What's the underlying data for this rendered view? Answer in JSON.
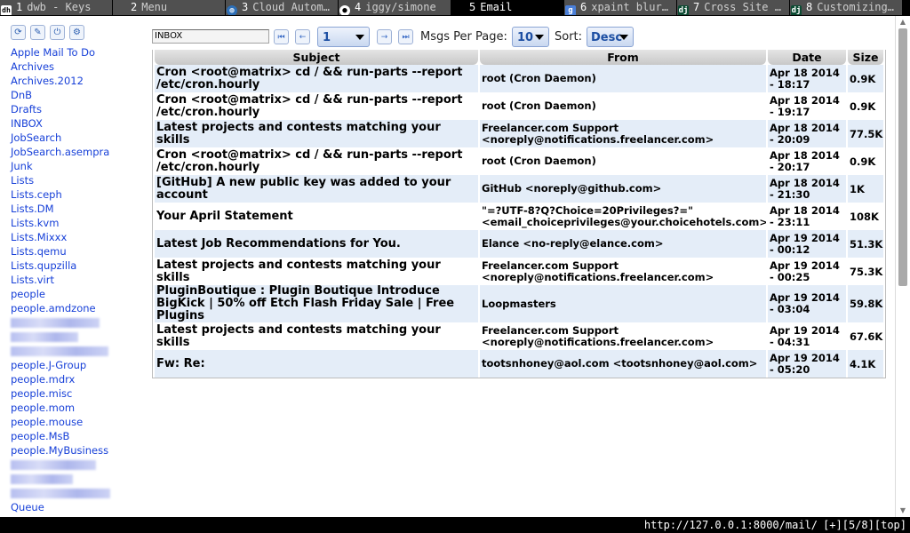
{
  "tabs": [
    {
      "num": "1",
      "title": "dwb - Keys",
      "icon": "dh",
      "active": false
    },
    {
      "num": "2",
      "title": "Menu",
      "icon": "",
      "active": false
    },
    {
      "num": "3",
      "title": "Cloud Autom…",
      "icon": "globe",
      "active": false
    },
    {
      "num": "4",
      "title": "iggy/simone",
      "icon": "github",
      "active": false
    },
    {
      "num": "5",
      "title": "Email",
      "icon": "",
      "active": true
    },
    {
      "num": "6",
      "title": "xpaint blur…",
      "icon": "g",
      "active": false
    },
    {
      "num": "7",
      "title": "Cross Site …",
      "icon": "dj",
      "active": false
    },
    {
      "num": "8",
      "title": "Customizing…",
      "icon": "dj",
      "active": false
    }
  ],
  "sidebar": {
    "tool_icons": [
      "refresh-icon",
      "compose-icon",
      "power-icon",
      "settings-icon"
    ],
    "folders": [
      {
        "label": "Apple Mail To Do"
      },
      {
        "label": "Archives"
      },
      {
        "label": "Archives.2012"
      },
      {
        "label": "DnB"
      },
      {
        "label": "Drafts"
      },
      {
        "label": "INBOX"
      },
      {
        "label": "JobSearch"
      },
      {
        "label": "JobSearch.asempra"
      },
      {
        "label": "Junk"
      },
      {
        "label": "Lists"
      },
      {
        "label": "Lists.ceph"
      },
      {
        "label": "Lists.DM"
      },
      {
        "label": "Lists.kvm"
      },
      {
        "label": "Lists.Mixxx"
      },
      {
        "label": "Lists.qemu"
      },
      {
        "label": "Lists.qupzilla"
      },
      {
        "label": "Lists.virt"
      },
      {
        "label": "people"
      },
      {
        "label": "people.amdzone"
      },
      {
        "label": "",
        "redacted": true
      },
      {
        "label": "",
        "redacted": true
      },
      {
        "label": "",
        "redacted": true
      },
      {
        "label": "people.J-Group"
      },
      {
        "label": "people.mdrx"
      },
      {
        "label": "people.misc"
      },
      {
        "label": "people.mom"
      },
      {
        "label": "people.mouse"
      },
      {
        "label": "people.MsB"
      },
      {
        "label": "people.MyBusiness"
      },
      {
        "label": "",
        "redacted": true
      },
      {
        "label": "",
        "redacted": true
      },
      {
        "label": "",
        "redacted": true
      },
      {
        "label": "Queue"
      }
    ]
  },
  "toolbar": {
    "mailbox": "INBOX",
    "page": "1",
    "per_page_label": "Msgs Per Page:",
    "per_page": "10",
    "sort_label": "Sort:",
    "sort": "Desc"
  },
  "table": {
    "headers": {
      "subject": "Subject",
      "from": "From",
      "date": "Date",
      "size": "Size"
    },
    "rows": [
      {
        "subject": "Cron <root@matrix> cd / && run-parts --report /etc/cron.hourly",
        "from": "root (Cron Daemon)",
        "date": "Apr 18 2014 - 18:17",
        "size": "0.9K"
      },
      {
        "subject": "Cron <root@matrix> cd / && run-parts --report /etc/cron.hourly",
        "from": "root (Cron Daemon)",
        "date": "Apr 18 2014 - 19:17",
        "size": "0.9K"
      },
      {
        "subject": "Latest projects and contests matching your skills",
        "from": "Freelancer.com Support <noreply@notifications.freelancer.com>",
        "date": "Apr 18 2014 - 20:09",
        "size": "77.5K"
      },
      {
        "subject": "Cron <root@matrix> cd / && run-parts --report /etc/cron.hourly",
        "from": "root (Cron Daemon)",
        "date": "Apr 18 2014 - 20:17",
        "size": "0.9K"
      },
      {
        "subject": "[GitHub] A new public key was added to your account",
        "from": "GitHub <noreply@github.com>",
        "date": "Apr 18 2014 - 21:30",
        "size": "1K"
      },
      {
        "subject": "Your April Statement",
        "from": "\"=?UTF-8?Q?Choice=20Privileges?=\" <email_choiceprivileges@your.choicehotels.com>",
        "date": "Apr 18 2014 - 23:11",
        "size": "108K"
      },
      {
        "subject": "Latest Job Recommendations for You.",
        "from": "Elance <no-reply@elance.com>",
        "date": "Apr 19 2014 - 00:12",
        "size": "51.3K"
      },
      {
        "subject": "Latest projects and contests matching your skills",
        "from": "Freelancer.com Support <noreply@notifications.freelancer.com>",
        "date": "Apr 19 2014 - 00:25",
        "size": "75.3K"
      },
      {
        "subject": "PluginBoutique : Plugin Boutique Introduce BigKick | 50% off Etch Flash Friday Sale | Free Plugins",
        "from": "Loopmasters",
        "date": "Apr 19 2014 - 03:04",
        "size": "59.8K"
      },
      {
        "subject": "Latest projects and contests matching your skills",
        "from": "Freelancer.com Support <noreply@notifications.freelancer.com>",
        "date": "Apr 19 2014 - 04:31",
        "size": "67.6K"
      },
      {
        "subject": "Fw: Re:",
        "from": "tootsnhoney@aol.com <tootsnhoney@aol.com>",
        "date": "Apr 19 2014 - 05:20",
        "size": "4.1K"
      }
    ]
  },
  "statusbar": {
    "url": "http://127.0.0.1:8000/mail/",
    "info": "[+][5/8][top]"
  }
}
